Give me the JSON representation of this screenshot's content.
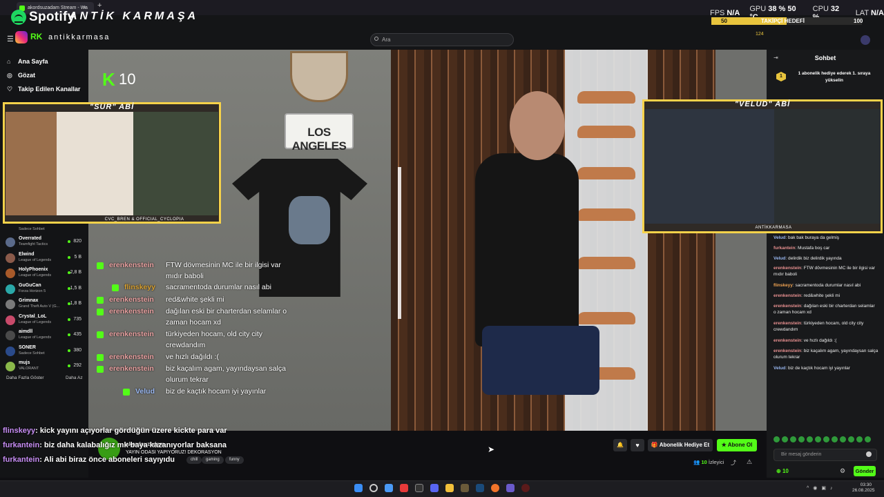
{
  "browser": {
    "tab_title": "akordsuzadam Stream - Wa",
    "tab_close": "×",
    "new_tab": "+"
  },
  "overlay": {
    "spotify_word": "Spotify",
    "brand": "ANTİK KARMAŞA",
    "insta_handle": "antikkarmasa",
    "kick_logo_text": "RK",
    "stats": {
      "fps_label": "FPS",
      "fps_value": "N/A",
      "gpu_label": "GPU",
      "gpu_value": "38 % 50 °C",
      "cpu_label": "CPU",
      "cpu_value": "32 %",
      "lat_label": "LAT",
      "lat_value": "N/A"
    },
    "follow_goal": {
      "current": "50",
      "label": "TAKİPÇİ HEDEFİ",
      "target": "100",
      "progress": 0.5
    },
    "cam1_title": "\"SUR\" ABİ",
    "cam1_tag": "CVC_BREN & OFFICIAL_CYCLOPIA",
    "cam2_title": "\"VELUD\" ABİ",
    "cam2_tag": "ANTİKKARMASA",
    "video_kick_n": "10",
    "plate_text": "LOS ANGELES",
    "colors": {
      "accent": "#53fc18",
      "frame": "#f6d24a"
    }
  },
  "search": {
    "placeholder": "Ara"
  },
  "top_counter": "124",
  "sidebar": {
    "nav": [
      {
        "label": "Ana Sayfa",
        "icon": "home-icon"
      },
      {
        "label": "Gözat",
        "icon": "compass-icon"
      },
      {
        "label": "Takip Edilen Kanallar",
        "icon": "heart-icon"
      }
    ],
    "partial_first_game": "Sadece Sohbet",
    "channels": [
      {
        "name": "Overrated",
        "game": "Teamfight Tactics",
        "viewers": "820",
        "color": "#5a6a8a"
      },
      {
        "name": "Elwind",
        "game": "League of Legends",
        "viewers": "5 B",
        "color": "#8a5a4a"
      },
      {
        "name": "HolyPhoenix",
        "game": "League of Legends",
        "viewers": "2,8 B",
        "color": "#a85a2a"
      },
      {
        "name": "GuGuCan",
        "game": "Forza Horizon 5",
        "viewers": "1,5 B",
        "color": "#2aa8a8"
      },
      {
        "name": "Grimnax",
        "game": "Grand Theft Auto V (G...",
        "viewers": "1,8 B",
        "color": "#7a7a7a"
      },
      {
        "name": "Crystal_LoL",
        "game": "League of Legends",
        "viewers": "735",
        "color": "#c84a6a"
      },
      {
        "name": "aimdll",
        "game": "League of Legends",
        "viewers": "435",
        "color": "#4a4a4a"
      },
      {
        "name": "SONER",
        "game": "Sadece Sohbet",
        "viewers": "380",
        "color": "#2a4a8a"
      },
      {
        "name": "mujs",
        "game": "VALORANT",
        "viewers": "292",
        "color": "#8ab84a"
      }
    ],
    "more": "Daha Fazla Göster",
    "less": "Daha Az"
  },
  "video_chat": [
    {
      "user": "erenkenstein",
      "msg": "FTW dövmesinin MC ile bir ilgisi var mıdır baboli"
    },
    {
      "user": "flinskeyy",
      "msg": "sacramentoda durumlar nasıl abi"
    },
    {
      "user": "erenkenstein",
      "msg": "red&white şekli mi"
    },
    {
      "user": "erenkenstein",
      "msg": "dağılan eski bir charterdan selamlar o zaman hocam xd"
    },
    {
      "user": "erenkenstein",
      "msg": "türkiyeden hocam, old city city crewdandım"
    },
    {
      "user": "erenkenstein",
      "msg": "ve hızlı dağıldı :("
    },
    {
      "user": "erenkenstein",
      "msg": "biz kaçalım agam, yayındaysan salça olurum tekrar"
    },
    {
      "user": "Velud",
      "msg": "biz de kaçtık hocam iyi yayınlar"
    }
  ],
  "bottom_chat": [
    {
      "user": "flinskeyy",
      "msg": ": kick yayını açıyorlar gördüğün üzere kickte para var"
    },
    {
      "user": "furkantein",
      "msg": ": biz daha kalabalığız mk baya kazanıyorlar baksana"
    },
    {
      "user": "furkantein",
      "msg": ": Ali abi biraz önce aboneleri sayıyıdu"
    }
  ],
  "stream": {
    "title": "YAYIN ODASI YAPIYORUZ! DEKORASYON",
    "streamer": "akordsuzadam",
    "tags": [
      "chill",
      "gaming",
      "funny"
    ],
    "gift_button": "Abonelik Hediye Et",
    "sub_button": "Abone Ol",
    "viewers_count": "10",
    "viewers_label": "İzleyici"
  },
  "chat": {
    "title": "Sohbet",
    "promo_rank": "1",
    "promo_text": "1 abonelik hediye ederek 1. sıraya yükselin",
    "messages": [
      {
        "user": "Velud",
        "msg": "bak bak buraya da gelmiş",
        "kind": "v"
      },
      {
        "user": "furkantein",
        "msg": "Mustafa boş car",
        "kind": "r"
      },
      {
        "user": "Velud",
        "msg": "delirdik biz delirdik yayında",
        "kind": "v"
      },
      {
        "user": "erenkenstein",
        "msg": "FTW dövmesinin MC ile bir ilgisi var mıdır baboli",
        "kind": "r"
      },
      {
        "user": "flinskeyy",
        "msg": "sacramentoda durumlar nasıl abi",
        "kind": "f"
      },
      {
        "user": "erenkenstein",
        "msg": "red&white şekli mi",
        "kind": "r"
      },
      {
        "user": "erenkenstein",
        "msg": "dağılan eski bir charterdan selamlar o zaman hocam xd",
        "kind": "r"
      },
      {
        "user": "erenkenstein",
        "msg": "türkiyeden hocam, old city city crewdandım",
        "kind": "r"
      },
      {
        "user": "erenkenstein",
        "msg": "ve hızlı dağıldı :(",
        "kind": "r"
      },
      {
        "user": "erenkenstein",
        "msg": "biz kaçalım agam, yayındaysan salça olurum tekrar",
        "kind": "r"
      },
      {
        "user": "Velud",
        "msg": "biz de kaçtık hocam iyi yayınlar",
        "kind": "v"
      }
    ],
    "input_placeholder": "Bir mesaj gönderin",
    "points": "10",
    "send": "Gönder"
  },
  "taskbar": {
    "time": "03:30",
    "date": "26.08.2025"
  }
}
